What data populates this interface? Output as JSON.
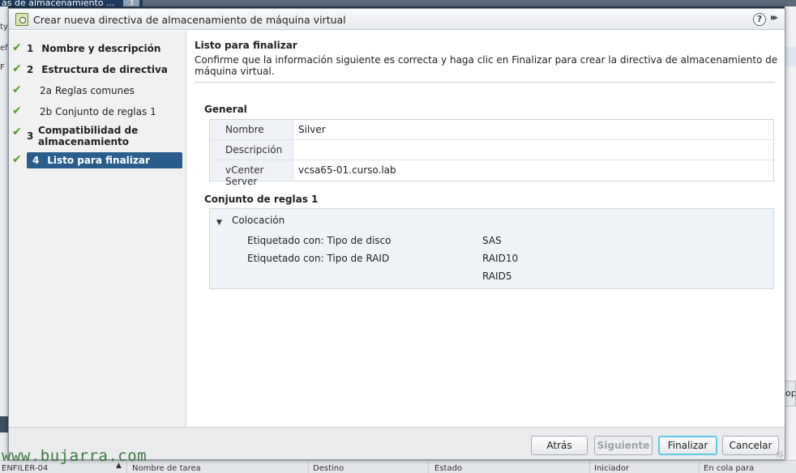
{
  "background": {
    "tab_label": "as de almacenamiento ...",
    "tab_badge": "3",
    "left_fragments": [
      "ty",
      "ef",
      "F"
    ],
    "right_fragment": "op",
    "bottom_bar": {
      "host": "ENFILER-04",
      "columns": [
        "Nombre de tarea",
        "Destino",
        "Estado",
        "Iniciador",
        "En cola para"
      ]
    },
    "watermark": "www.bujarra.com"
  },
  "dialog": {
    "title": "Crear nueva directiva de almacenamiento de máquina virtual",
    "help_label": "?",
    "expand_label": "▸▸",
    "steps": [
      {
        "num": "1",
        "label": "Nombre y descripción",
        "completed": true,
        "bold": true
      },
      {
        "num": "2",
        "label": "Estructura de directiva",
        "completed": true,
        "bold": true
      },
      {
        "num": "2a",
        "label": "Reglas comunes",
        "completed": true,
        "bold": false
      },
      {
        "num": "2b",
        "label": "Conjunto de reglas 1",
        "completed": true,
        "bold": false
      },
      {
        "num": "3",
        "label": "Compatibilidad de almacenamiento",
        "completed": true,
        "bold": true
      },
      {
        "num": "4",
        "label": "Listo para finalizar",
        "completed": true,
        "bold": true,
        "active": true
      }
    ],
    "content": {
      "heading": "Listo para finalizar",
      "description": "Confirme que la información siguiente es correcta y haga clic en Finalizar para crear la directiva de almacenamiento de máquina virtual.",
      "general": {
        "title": "General",
        "rows": [
          {
            "key": "Nombre",
            "value": "Silver"
          },
          {
            "key": "Descripción",
            "value": ""
          },
          {
            "key": "vCenter Server",
            "value": "vcsa65-01.curso.lab"
          }
        ]
      },
      "ruleset": {
        "title": "Conjunto de reglas 1",
        "group": "Colocación",
        "rows": [
          {
            "key": "Etiquetado con: Tipo de disco",
            "value": "SAS"
          },
          {
            "key": "Etiquetado con: Tipo de RAID",
            "value": "RAID10"
          },
          {
            "key": "",
            "value": "RAID5"
          }
        ]
      }
    },
    "buttons": {
      "back": "Atrás",
      "next": "Siguiente",
      "finish": "Finalizar",
      "cancel": "Cancelar"
    }
  },
  "colors": {
    "accent": "#2a5d8c",
    "check": "#4a9a2e",
    "focus": "#5ccbe6"
  }
}
